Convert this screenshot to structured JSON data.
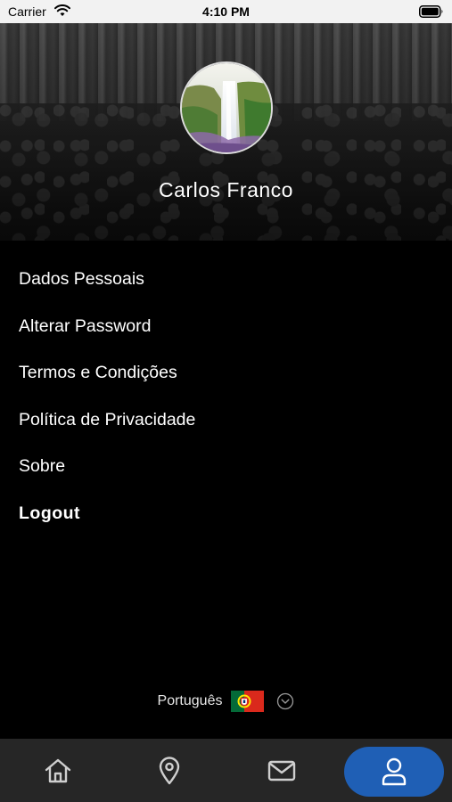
{
  "status_bar": {
    "carrier": "Carrier",
    "time": "4:10 PM"
  },
  "profile": {
    "name": "Carlos Franco",
    "avatar_icon": "waterfall-photo"
  },
  "menu": {
    "items": [
      "Dados Pessoais",
      "Alterar Password",
      "Termos e Condições",
      "Política de Privacidade",
      "Sobre"
    ],
    "logout": "Logout"
  },
  "language": {
    "label": "Português",
    "flag_icon": "portugal-flag-icon",
    "dropdown_icon": "chevron-down-circle-icon"
  },
  "tab_bar": {
    "tabs": [
      {
        "icon": "home-icon",
        "active": false
      },
      {
        "icon": "location-pin-icon",
        "active": false
      },
      {
        "icon": "envelope-icon",
        "active": false
      },
      {
        "icon": "user-icon",
        "active": true
      }
    ],
    "active_color": "#1f5fb5",
    "background_color": "#262626"
  },
  "colors": {
    "background": "#000000",
    "text": "#ffffff",
    "status_bar": "#f2f2f2"
  }
}
